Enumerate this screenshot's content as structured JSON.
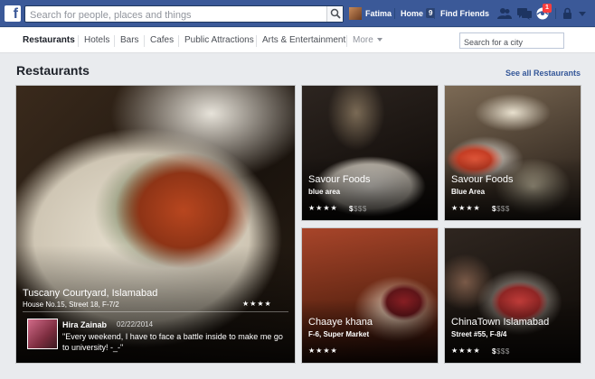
{
  "header": {
    "logo": "f",
    "search_placeholder": "Search for people, places and things",
    "user_name": "Fatima",
    "home_label": "Home",
    "home_count": "9",
    "find_friends_label": "Find Friends",
    "notification_count": "1",
    "jewels": [
      "friend-requests-icon",
      "messages-icon",
      "notifications-icon",
      "privacy-icon"
    ]
  },
  "subnav": {
    "tabs": [
      {
        "label": "Restaurants",
        "active": true
      },
      {
        "label": "Hotels"
      },
      {
        "label": "Bars"
      },
      {
        "label": "Cafes"
      },
      {
        "label": "Public Attractions"
      },
      {
        "label": "Arts & Entertainment"
      }
    ],
    "more_label": "More",
    "city_placeholder": "Search for a city"
  },
  "section": {
    "title": "Restaurants",
    "see_all": "See all Restaurants"
  },
  "cards": [
    {
      "name": "Tuscany Courtyard, Islamabad",
      "address": "House No.15, Street 18, F-7/2",
      "rating": "★★★★",
      "review": {
        "author": "Hira Zainab",
        "date": "02/22/2014",
        "text": "\"Every weekend, I have to face a battle inside to make me go to university! -_-\""
      }
    },
    {
      "name": "Savour Foods",
      "address": "blue area",
      "rating": "★★★★",
      "price_on": "$",
      "price_off": "$$$"
    },
    {
      "name": "Savour Foods",
      "address": "Blue Area",
      "rating": "★★★★",
      "price_on": "$",
      "price_off": "$$$"
    },
    {
      "name": "Chaaye khana",
      "address": "F-6, Super Market",
      "rating": "★★★★"
    },
    {
      "name": "ChinaTown Islamabad",
      "address": "Street #55, F-8/4",
      "rating": "★★★★",
      "price_on": "$",
      "price_off": "$$$"
    }
  ],
  "colors": {
    "brand_blue": "#3b5998",
    "link_blue": "#365899",
    "page_bg": "#e9ebee",
    "badge_red": "#fa3e3e"
  }
}
